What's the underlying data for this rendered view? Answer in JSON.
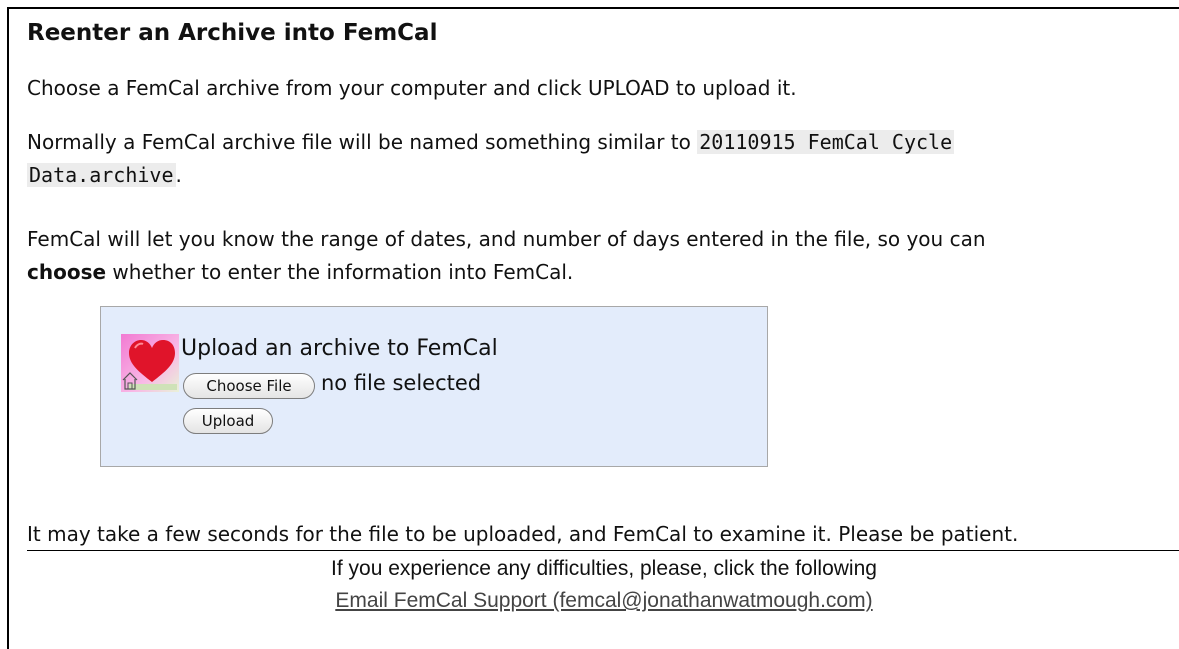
{
  "page": {
    "title": "Reenter an Archive into FemCal",
    "para1": "Choose a FemCal archive from your computer and click UPLOAD to upload it.",
    "para2_line1_text": "Normally a FemCal archive file will be named something similar to ",
    "para2_filename_part1": "20110915 FemCal Cycle",
    "para2_filename_part2": "Data.archive",
    "para2_end": ".",
    "para3_line1": "FemCal will let you know the range of dates, and number of days entered in the file, so you can",
    "para3_bold": "choose",
    "para3_line2_rest": " whether to enter the information into FemCal.",
    "para4": "It may take a few seconds for the file to be uploaded, and FemCal to examine it. Please be patient."
  },
  "upload_form": {
    "heading": "Upload an archive to FemCal",
    "choose_file_label": "Choose File",
    "file_status": "no file selected",
    "upload_label": "Upload",
    "icon": "femcal-heart-icon"
  },
  "footer": {
    "text": "If you experience any difficulties, please, click the following",
    "link_text": "Email FemCal Support (femcal@jonathanwatmough.com)"
  },
  "colors": {
    "upload_box_bg": "#e3ecfb",
    "code_bg": "#ececec",
    "heart": "#e0142a",
    "icon_bg": "#f58fd8"
  }
}
